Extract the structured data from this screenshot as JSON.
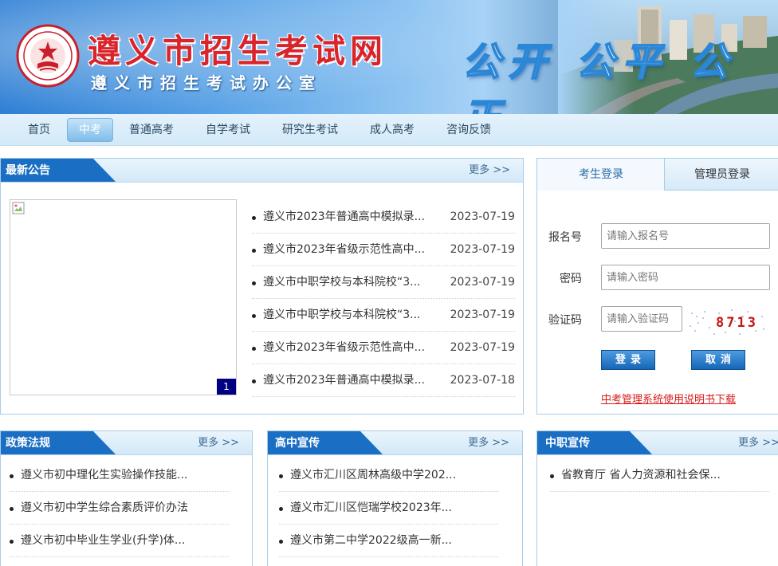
{
  "header": {
    "site_title": "遵义市招生考试网",
    "site_subtitle": "遵义市招生考试办公室",
    "slogan": "公开 公平 公正"
  },
  "nav": {
    "active": "中考",
    "items": [
      {
        "label": "首页"
      },
      {
        "label": "中考"
      },
      {
        "label": "普通高考"
      },
      {
        "label": "自学考试"
      },
      {
        "label": "研究生考试"
      },
      {
        "label": "成人高考"
      },
      {
        "label": "咨询反馈"
      }
    ]
  },
  "announcements": {
    "title": "最新公告",
    "more": "更多 >>",
    "slide_index": "1",
    "items": [
      {
        "title": "遵义市2023年普通高中模拟录...",
        "date": "2023-07-19"
      },
      {
        "title": "遵义市2023年省级示范性高中...",
        "date": "2023-07-19"
      },
      {
        "title": "遵义市中职学校与本科院校“3...",
        "date": "2023-07-19"
      },
      {
        "title": "遵义市中职学校与本科院校“3...",
        "date": "2023-07-19"
      },
      {
        "title": "遵义市2023年省级示范性高中...",
        "date": "2023-07-19"
      },
      {
        "title": "遵义市2023年普通高中模拟录...",
        "date": "2023-07-18"
      }
    ]
  },
  "login": {
    "tab_student": "考生登录",
    "tab_admin": "管理员登录",
    "active_tab": "考生登录",
    "reg_label": "报名号",
    "reg_placeholder": "请输入报名号",
    "pwd_label": "密码",
    "pwd_placeholder": "请输入密码",
    "captcha_label": "验证码",
    "captcha_placeholder": "请输入验证码",
    "captcha_code": "8713",
    "login_button": "登录",
    "cancel_button": "取消",
    "manual_link": "中考管理系统使用说明书下载"
  },
  "policy": {
    "title": "政策法规",
    "more": "更多 >>",
    "items": [
      {
        "title": "遵义市初中理化生实验操作技能..."
      },
      {
        "title": "遵义市初中学生综合素质评价办法"
      },
      {
        "title": "遵义市初中毕业生学业(升学)体..."
      }
    ]
  },
  "highschool": {
    "title": "高中宣传",
    "more": "更多 >>",
    "items": [
      {
        "title": "遵义市汇川区周林高级中学202..."
      },
      {
        "title": "遵义市汇川区恺瑞学校2023年..."
      },
      {
        "title": "遵义市第二中学2022级高一新..."
      }
    ]
  },
  "vocational": {
    "title": "中职宣传",
    "more": "更多 >>",
    "items": [
      {
        "title": "省教育厅 省人力资源和社会保..."
      }
    ]
  },
  "colors": {
    "accent_blue": "#1a6fc4",
    "title_red": "#d8242a",
    "link_red": "#d61c1c",
    "slide_num_bg": "#000080"
  }
}
